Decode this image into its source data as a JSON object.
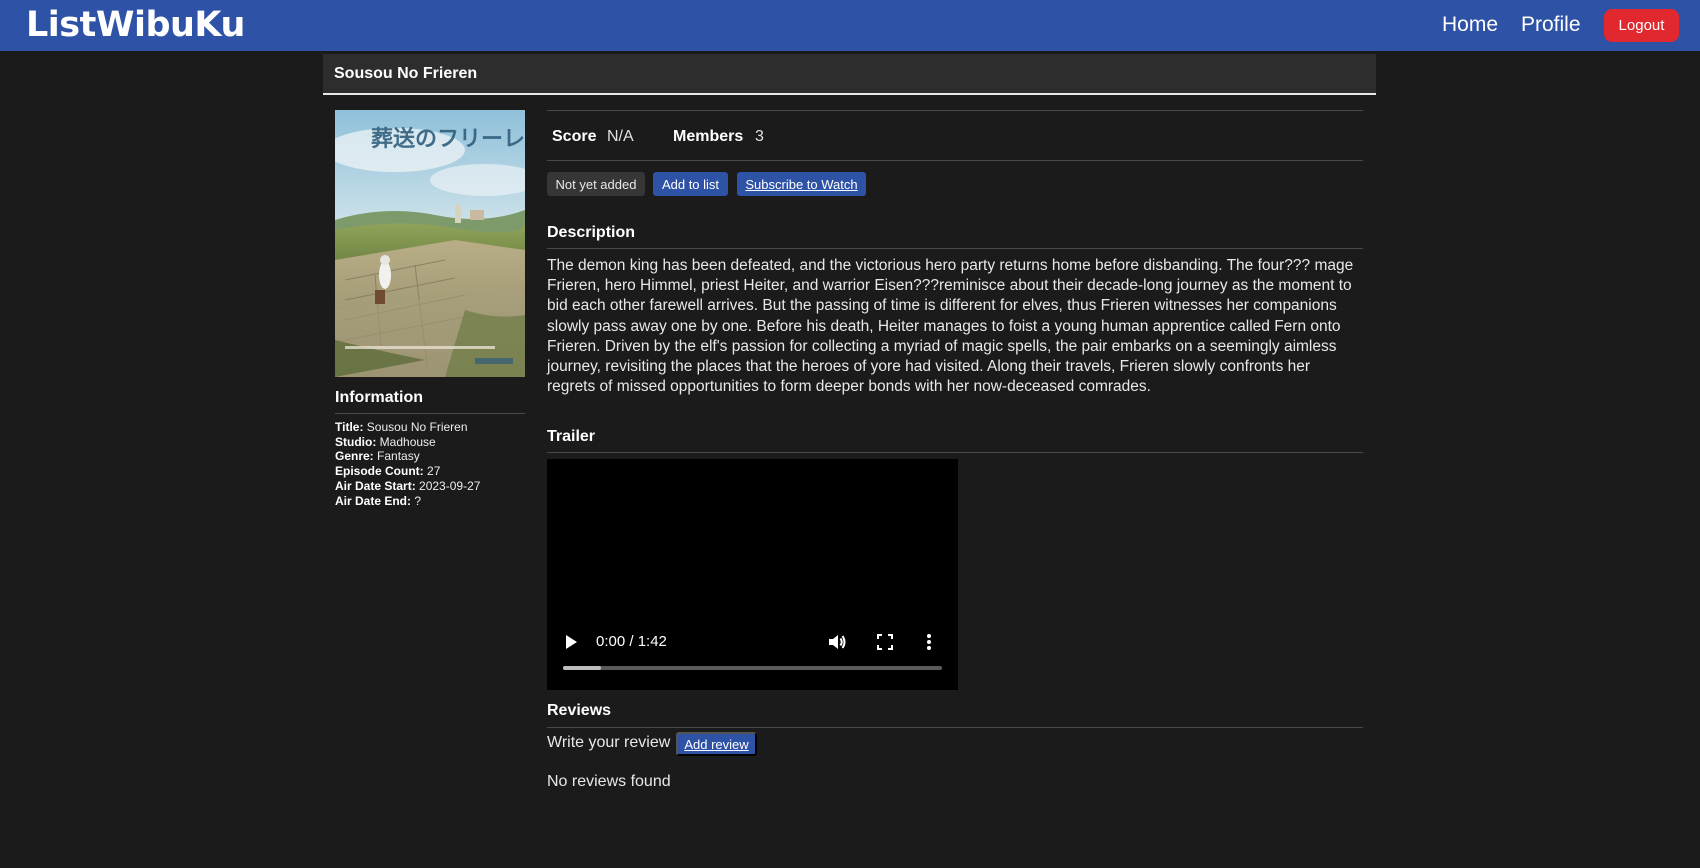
{
  "navbar": {
    "brand": "ListWibuKu",
    "home_label": "Home",
    "profile_label": "Profile",
    "logout_label": "Logout",
    "color": "#2e52a6",
    "logout_color": "#e0282e"
  },
  "anime": {
    "title": "Sousou No Frieren",
    "cover_icon": "frieren-cover-art"
  },
  "information": {
    "heading": "Information",
    "rows": [
      {
        "label": "Title:",
        "value": "Sousou No Frieren"
      },
      {
        "label": "Studio:",
        "value": "Madhouse"
      },
      {
        "label": "Genre:",
        "value": "Fantasy"
      },
      {
        "label": "Episode Count:",
        "value": "27"
      },
      {
        "label": "Air Date Start:",
        "value": "2023-09-27"
      },
      {
        "label": "Air Date End:",
        "value": "?"
      }
    ]
  },
  "stats": {
    "score_label": "Score",
    "score_value": "N/A",
    "members_label": "Members",
    "members_value": "3"
  },
  "actions": {
    "status": "Not yet added",
    "add_to_list": "Add to list",
    "subscribe": "Subscribe to Watch"
  },
  "description": {
    "heading": "Description",
    "text": "The demon king has been defeated, and the victorious hero party returns home before disbanding. The four??? mage Frieren, hero Himmel, priest Heiter, and warrior Eisen???reminisce about their decade-long journey as the moment to bid each other farewell arrives. But the passing of time is different for elves, thus Frieren witnesses her companions slowly pass away one by one. Before his death, Heiter manages to foist a young human apprentice called Fern onto Frieren. Driven by the elf's passion for collecting a myriad of magic spells, the pair embarks on a seemingly aimless journey, revisiting the places that the heroes of yore had visited. Along their travels, Frieren slowly confronts her regrets of missed opportunities to form deeper bonds with her now-deceased comrades."
  },
  "trailer": {
    "heading": "Trailer",
    "time": "0:00 / 1:42",
    "buffered_fraction": 0.1
  },
  "reviews": {
    "heading": "Reviews",
    "prompt": "Write your review",
    "add_label": "Add review",
    "empty_text": "No reviews found"
  }
}
